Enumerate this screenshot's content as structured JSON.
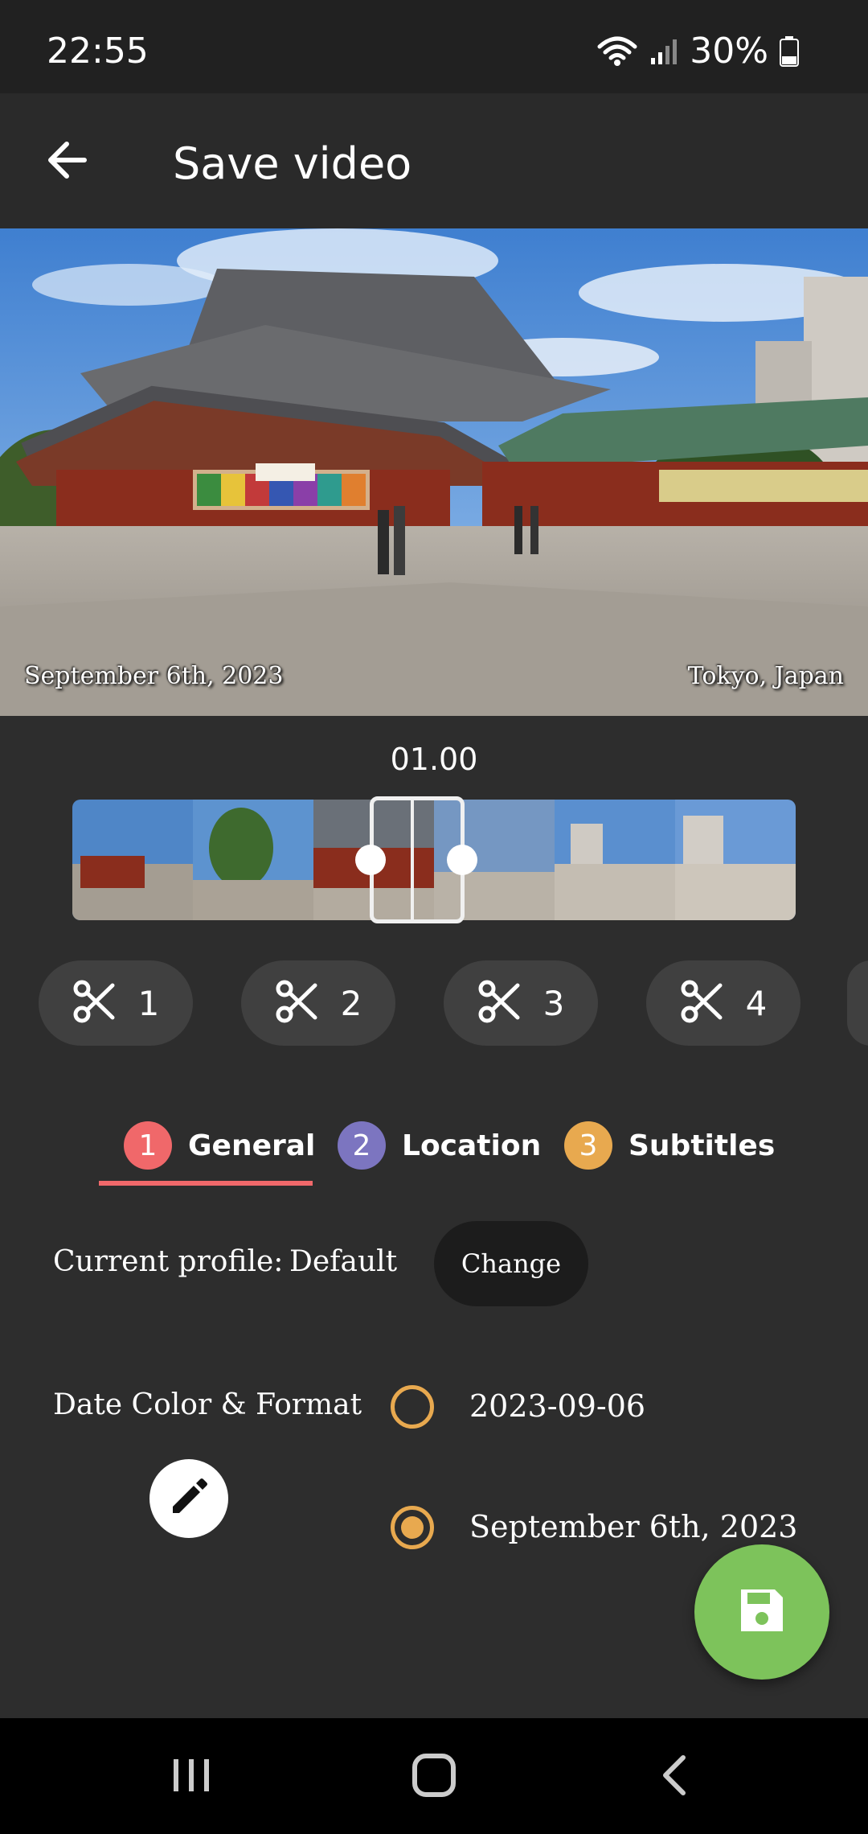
{
  "status_bar": {
    "time": "22:55",
    "battery_percent": "30%",
    "icons": [
      "wifi-icon",
      "signal-icon",
      "battery-icon"
    ]
  },
  "app_bar": {
    "title": "Save video",
    "back_icon": "arrow-back-icon"
  },
  "preview": {
    "date_overlay": "September 6th, 2023",
    "location_overlay": "Tokyo, Japan"
  },
  "timeline": {
    "time_readout": "01.00"
  },
  "clips": [
    {
      "label": "1",
      "icon": "scissors-icon"
    },
    {
      "label": "2",
      "icon": "scissors-icon"
    },
    {
      "label": "3",
      "icon": "scissors-icon"
    },
    {
      "label": "4",
      "icon": "scissors-icon"
    }
  ],
  "tabs": [
    {
      "number": "1",
      "label": "General",
      "color": "#f0686a",
      "active": true
    },
    {
      "number": "2",
      "label": "Location",
      "color": "#7c75c0",
      "active": false
    },
    {
      "number": "3",
      "label": "Subtitles",
      "color": "#e8a94f",
      "active": false
    }
  ],
  "profile": {
    "label": "Current profile:",
    "value": "Default",
    "change_label": "Change"
  },
  "date_format": {
    "label": "Date Color & Format",
    "edit_icon": "pencil-icon",
    "options": [
      {
        "label": "2023-09-06",
        "selected": false
      },
      {
        "label": "September 6th, 2023",
        "selected": true
      }
    ],
    "radio_color": "#e8a94f"
  },
  "fab": {
    "icon": "save-icon",
    "color": "#7dc35b"
  },
  "nav_bar": {
    "buttons": [
      "recents-icon",
      "home-icon",
      "back-icon"
    ]
  }
}
